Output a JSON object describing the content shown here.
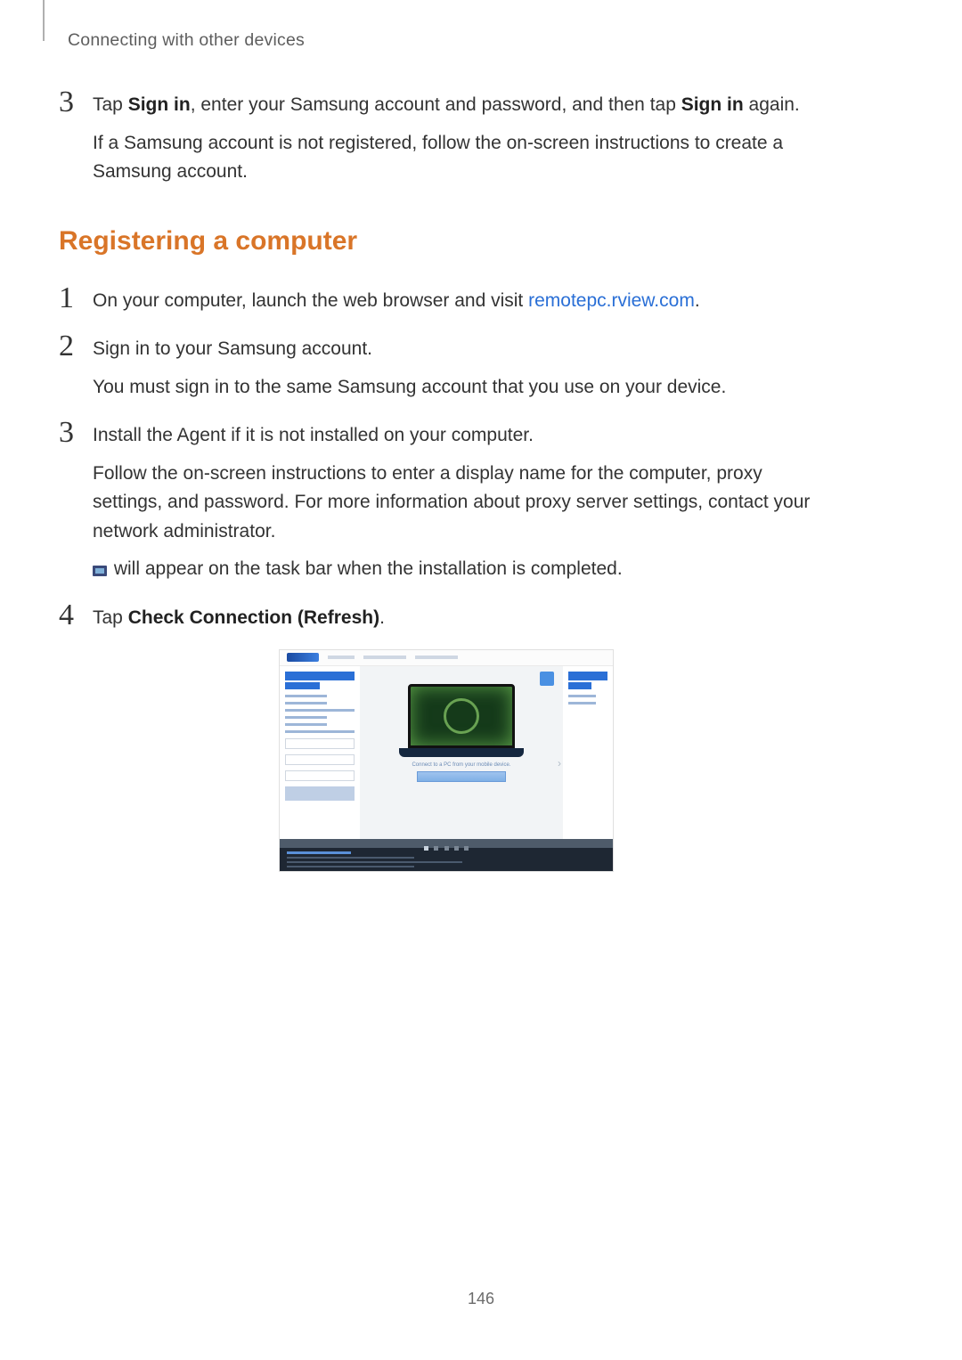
{
  "header": {
    "title": "Connecting with other devices"
  },
  "topStep": {
    "num": "3",
    "part_a": "Tap ",
    "bold_a": "Sign in",
    "part_b": ", enter your Samsung account and password, and then tap ",
    "bold_b": "Sign in",
    "part_c": " again.",
    "sub": "If a Samsung account is not registered, follow the on-screen instructions to create a Samsung account."
  },
  "section": {
    "heading": "Registering a computer"
  },
  "steps": [
    {
      "num": "1",
      "pre": "On your computer, launch the web browser and visit ",
      "link": "remotepc.rview.com",
      "post": "."
    },
    {
      "num": "2",
      "line": "Sign in to your Samsung account.",
      "sub": "You must sign in to the same Samsung account that you use on your device."
    },
    {
      "num": "3",
      "line": "Install the Agent if it is not installed on your computer.",
      "sub": "Follow the on-screen instructions to enter a display name for the computer, proxy settings, and password. For more information about proxy server settings, contact your network administrator.",
      "iconline_post": " will appear on the task bar when the installation is completed."
    },
    {
      "num": "4",
      "pre": "Tap ",
      "bold": "Check Connection (Refresh)",
      "post": "."
    }
  ],
  "figure": {
    "caption": "Connect to a PC from your mobile device."
  },
  "page": {
    "number": "146"
  }
}
